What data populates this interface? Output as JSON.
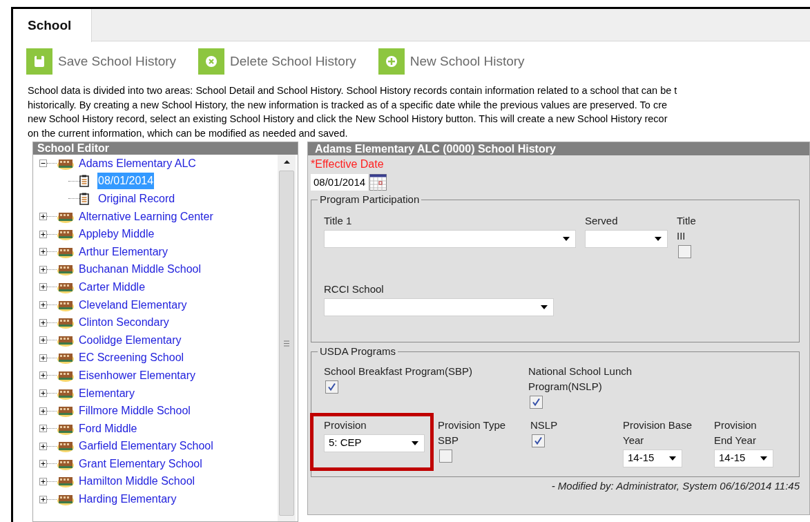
{
  "tab": {
    "label": "School",
    "selected": true
  },
  "toolbar": [
    {
      "kind": "save",
      "label": "Save School History"
    },
    {
      "kind": "delete",
      "label": "Delete School History"
    },
    {
      "kind": "new",
      "label": "New School History"
    }
  ],
  "description_lines": [
    "School data is divided into two areas: School Detail and School History. School History records contain information related to a school that can be t",
    "historically. By creating a new School History, the new information is tracked as of a specific date while the previous values are preserved. To cre",
    "new School History record, select an existing School History and click the New School History button. This will create a new School History recor",
    "on the current information, which can be modified as needed and saved."
  ],
  "school_editor": {
    "title": "School Editor",
    "tree": [
      {
        "label": "Adams Elementary ALC",
        "expanded": true,
        "selected": false,
        "children": [
          {
            "label": "08/01/2014",
            "selected": true
          },
          {
            "label": "Original Record",
            "selected": false
          }
        ]
      },
      {
        "label": "Alternative Learning Center",
        "expanded": false,
        "selected": false
      },
      {
        "label": "Appleby Middle",
        "expanded": false,
        "selected": false
      },
      {
        "label": "Arthur Elementary",
        "expanded": false,
        "selected": false
      },
      {
        "label": "Buchanan Middle School",
        "expanded": false,
        "selected": false
      },
      {
        "label": "Carter Middle",
        "expanded": false,
        "selected": false
      },
      {
        "label": "Cleveland Elementary",
        "expanded": false,
        "selected": false
      },
      {
        "label": "Clinton Secondary",
        "expanded": false,
        "selected": false
      },
      {
        "label": "Coolidge Elementary",
        "expanded": false,
        "selected": false
      },
      {
        "label": "EC Screening School",
        "expanded": false,
        "selected": false
      },
      {
        "label": "Eisenhower Elementary",
        "expanded": false,
        "selected": false
      },
      {
        "label": "Elementary",
        "expanded": false,
        "selected": false
      },
      {
        "label": "Fillmore Middle School",
        "expanded": false,
        "selected": false
      },
      {
        "label": "Ford Middle",
        "expanded": false,
        "selected": false
      },
      {
        "label": "Garfield Elementary School",
        "expanded": false,
        "selected": false
      },
      {
        "label": "Grant Elementary School",
        "expanded": false,
        "selected": false
      },
      {
        "label": "Hamilton Middle School",
        "expanded": false,
        "selected": false
      },
      {
        "label": "Harding Elementary",
        "expanded": false,
        "selected": false
      }
    ]
  },
  "school_history": {
    "title": "Adams Elementary ALC (0000) School History",
    "effective_date": {
      "label": "*Effective Date",
      "value": "08/01/2014"
    },
    "program_participation": {
      "legend": "Program Participation",
      "participation_fields": [
        {
          "kind": "select",
          "label": "Title 1"
        },
        {
          "kind": "select",
          "label": "Served"
        },
        {
          "kind": "checkbox",
          "label": "Title III",
          "checked": false
        }
      ],
      "rcci_field": {
        "kind": "select",
        "label": "RCCI School"
      }
    },
    "usda_programs": {
      "legend": "USDA Programs",
      "meal_programs": [
        {
          "kind": "checkbox",
          "label": "School Breakfast Program(SBP)",
          "checked": true,
          "highlighted": false
        },
        {
          "kind": "checkbox",
          "label": "National School Lunch Program(NSLP)",
          "checked": true,
          "highlighted": false
        }
      ],
      "provision_fields": [
        {
          "kind": "select",
          "label": "Provision",
          "value": "5: CEP",
          "highlighted": true
        },
        {
          "kind": "checkbox",
          "label": "Provision Type SBP",
          "checked": false,
          "highlighted": false
        },
        {
          "kind": "checkbox",
          "label": "NSLP",
          "checked": true,
          "highlighted": false
        },
        {
          "kind": "select",
          "label": "Provision Base Year",
          "value": "14-15",
          "highlighted": false
        },
        {
          "kind": "select",
          "label": "Provision End Year",
          "value": "14-15",
          "highlighted": false
        }
      ]
    },
    "modified": "- Modified by: Administrator, System 06/16/2014 11:45"
  }
}
